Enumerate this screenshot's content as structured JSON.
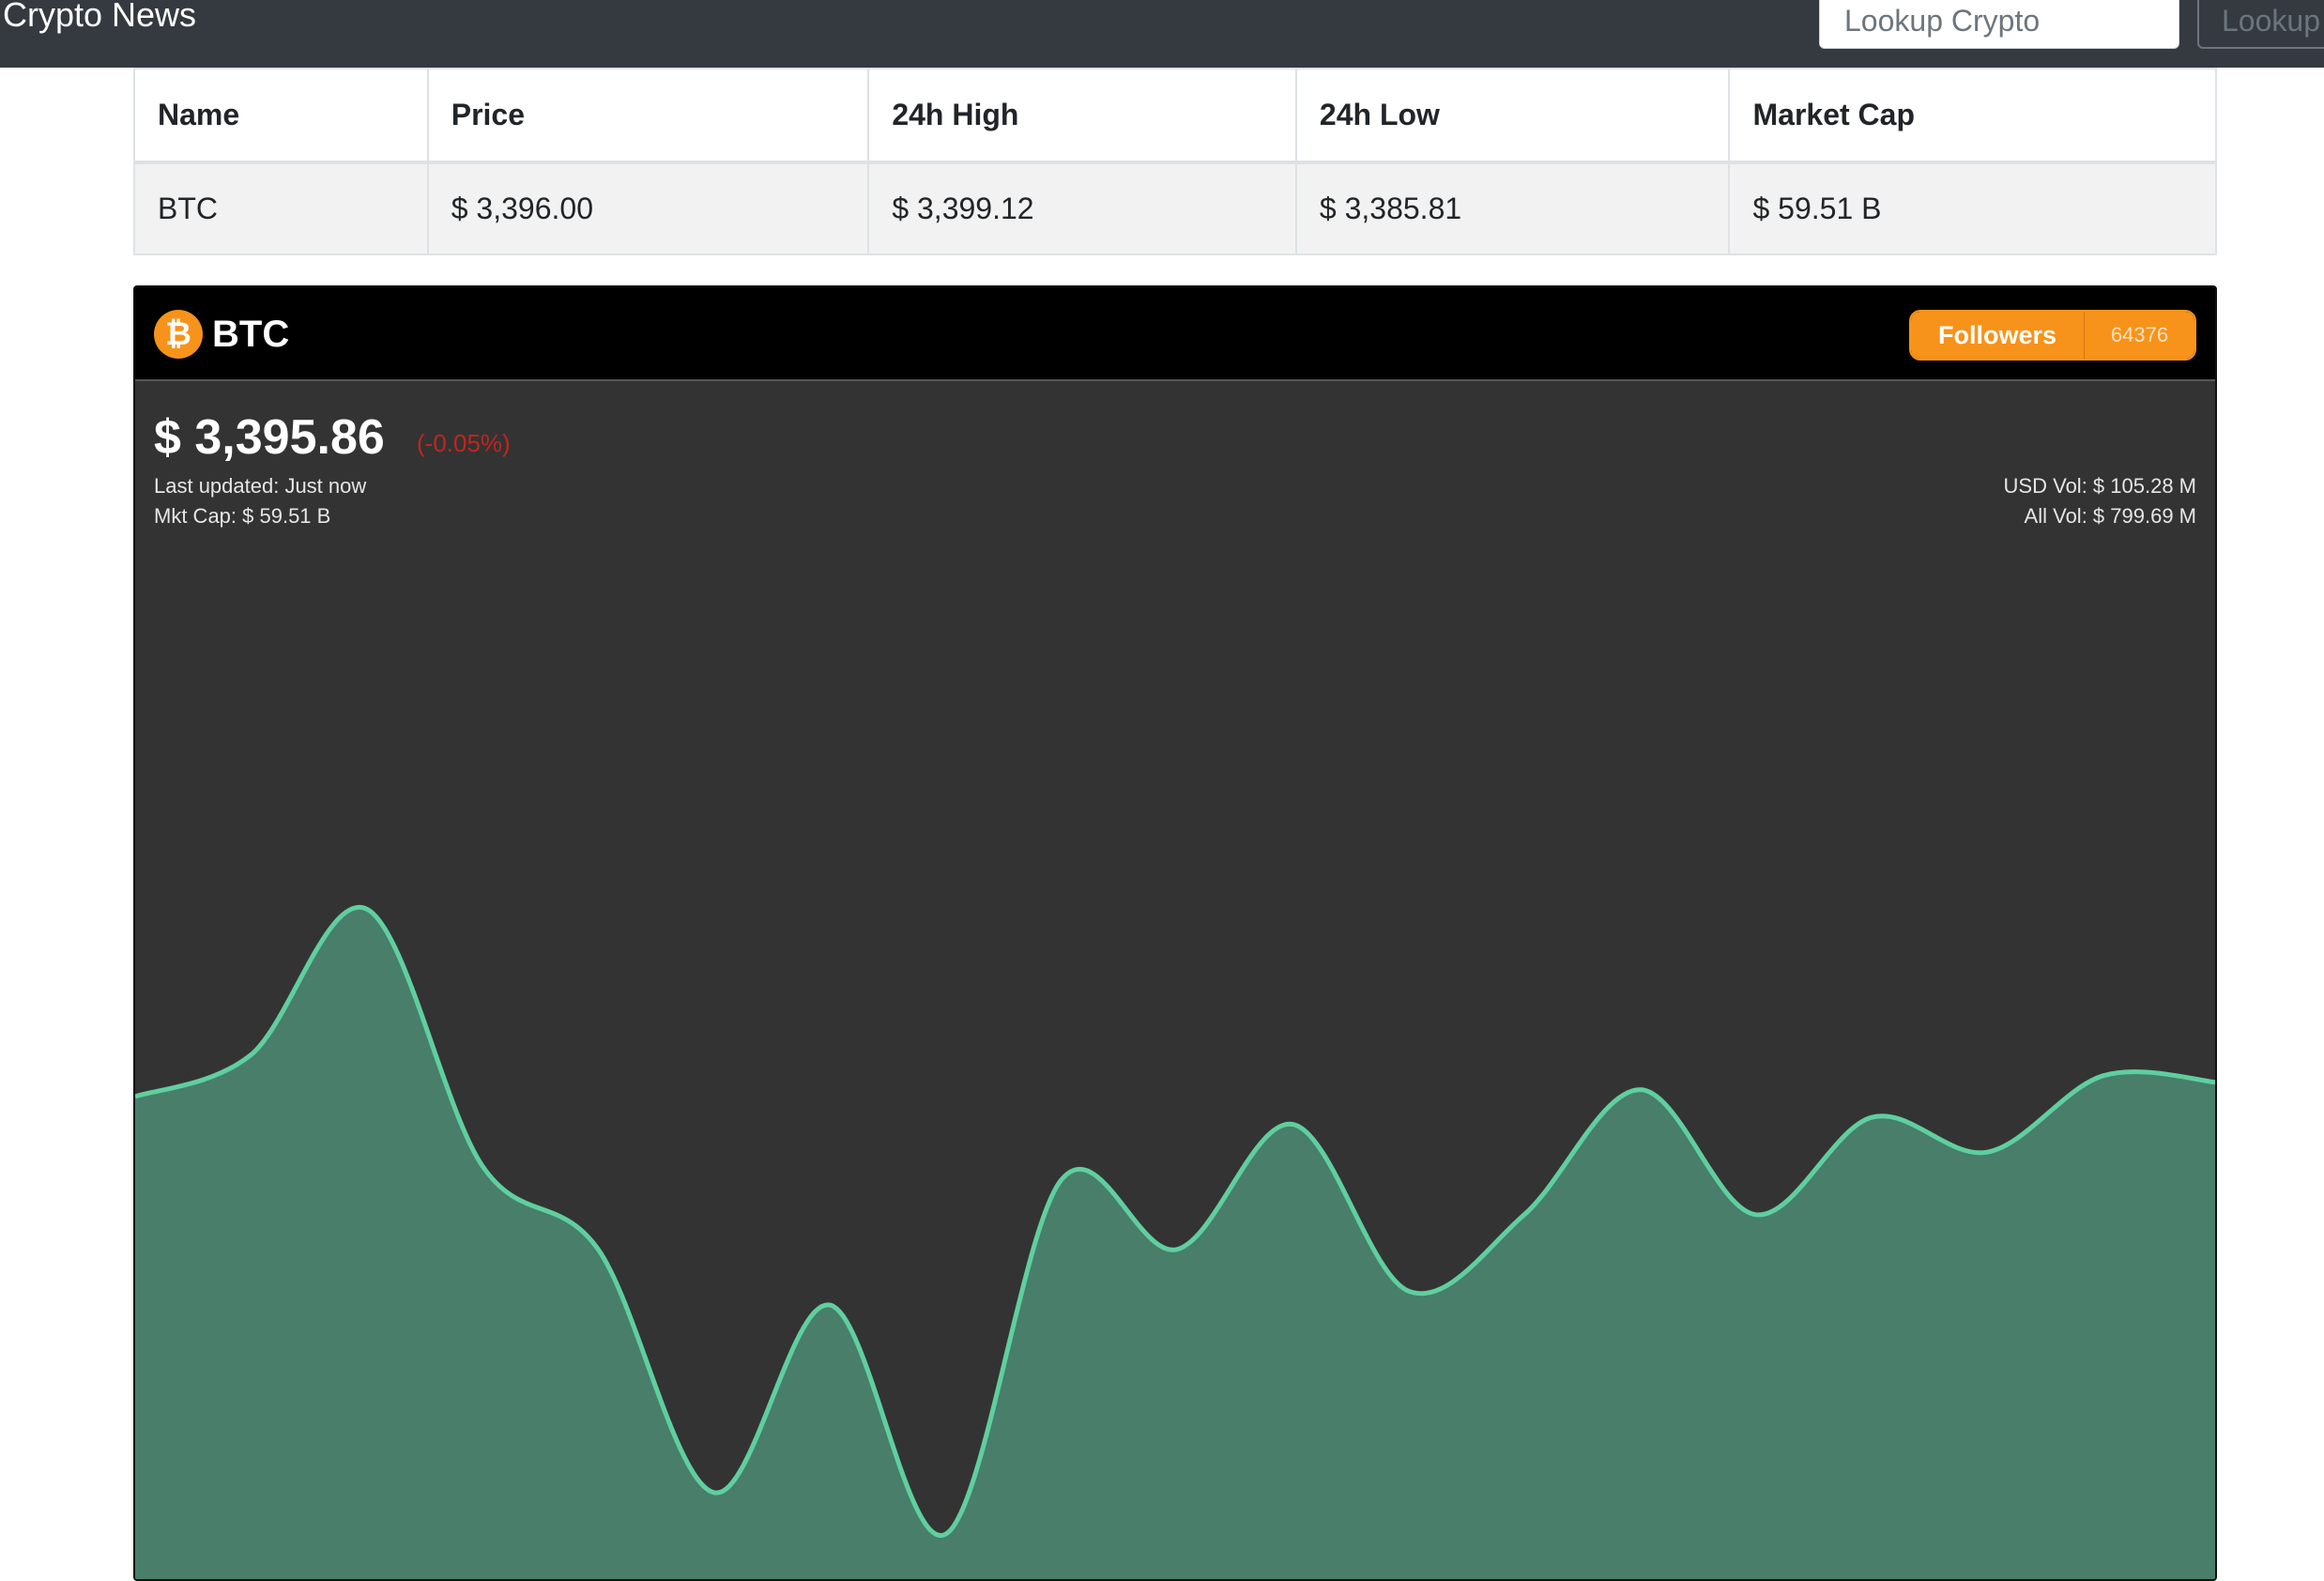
{
  "navbar": {
    "brand": "Crypto News",
    "search_placeholder": "Lookup Crypto",
    "search_button": "Lookup"
  },
  "table": {
    "headers": [
      "Name",
      "Price",
      "24h High",
      "24h Low",
      "Market Cap"
    ],
    "rows": [
      [
        "BTC",
        "$ 3,396.00",
        "$ 3,399.12",
        "$ 3,385.81",
        "$ 59.51 B"
      ]
    ]
  },
  "widget": {
    "coin_icon": "bitcoin-icon",
    "coin_symbol": "₿",
    "coin_name": "BTC",
    "followers_label": "Followers",
    "followers_count": "64376",
    "price": "$ 3,395.86",
    "change": "(-0.05%)",
    "last_updated": "Last updated: Just now",
    "market_cap": "Mkt Cap: $ 59.51 B",
    "usd_volume": "USD Vol: $ 105.28 M",
    "all_volume": "All Vol: $ 799.69 M",
    "colors": {
      "accent": "#f7931a",
      "negative": "#c0261f",
      "line": "#5fcf9f",
      "area": "#487e6a",
      "background": "#333333"
    }
  },
  "chart_data": {
    "type": "area",
    "title": "",
    "xlabel": "",
    "ylabel": "",
    "grid": false,
    "y_range": [
      0,
      100
    ],
    "values": [
      70,
      76,
      97,
      60,
      48,
      13,
      40,
      7,
      58,
      48,
      66,
      42,
      53,
      71,
      53,
      67,
      62,
      73,
      72
    ]
  }
}
